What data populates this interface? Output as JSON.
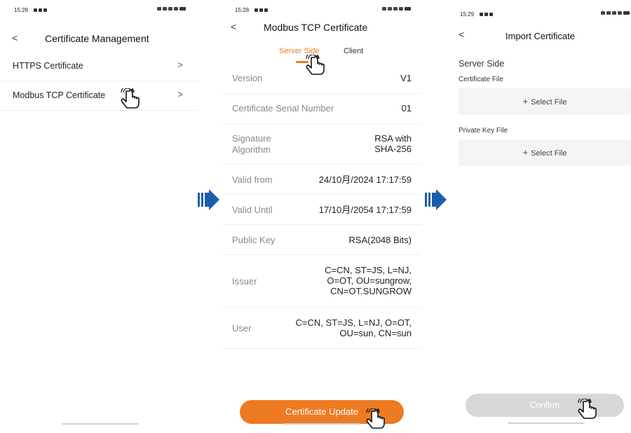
{
  "screens": [
    {
      "time": "15:28",
      "title": "Certificate Management",
      "back": "<",
      "items": [
        {
          "label": "HTTPS Certificate",
          "chevron": ">"
        },
        {
          "label": "Modbus TCP Certificate",
          "chevron": ">"
        }
      ]
    },
    {
      "time": "15:28",
      "title": "Modbus TCP Certificate",
      "back": "<",
      "tabs": [
        "Server Side",
        "Client"
      ],
      "active_tab": "Server Side",
      "rows": [
        {
          "key": "Version",
          "value": "V1"
        },
        {
          "key": "Certificate Serial Number",
          "value": "01"
        },
        {
          "key": "Signature\nAlgorithm",
          "value": "RSA with\nSHA-256"
        },
        {
          "key": "Valid from",
          "value": "24/10月/2024 17:17:59"
        },
        {
          "key": "Valid Until",
          "value": "17/10月/2054 17:17:59"
        },
        {
          "key": "Public Key",
          "value": "RSA(2048 Bits)"
        },
        {
          "key": "Issuer",
          "value": "C=CN, ST=JS, L=NJ,\nO=OT, OU=sungrow,\nCN=OT.SUNGROW"
        },
        {
          "key": "User",
          "value": "C=CN, ST=JS, L=NJ, O=OT,\nOU=sun, CN=sun"
        }
      ],
      "button": "Certificate Update"
    },
    {
      "time": "15:29",
      "title": "Import Certificate",
      "back": "<",
      "section": "Server Side",
      "cert_label": "Certificate File",
      "key_label": "Private Key File",
      "select_label": "Select File",
      "plus": "+",
      "button": "Confirm"
    }
  ],
  "icons": {
    "step_arrow": "arrow-right-icon",
    "tap": "hand-pointer-icon"
  },
  "colors": {
    "accent": "#ee7a22",
    "arrow": "#1a5fad",
    "disabled_button": "#d7d7d7"
  }
}
